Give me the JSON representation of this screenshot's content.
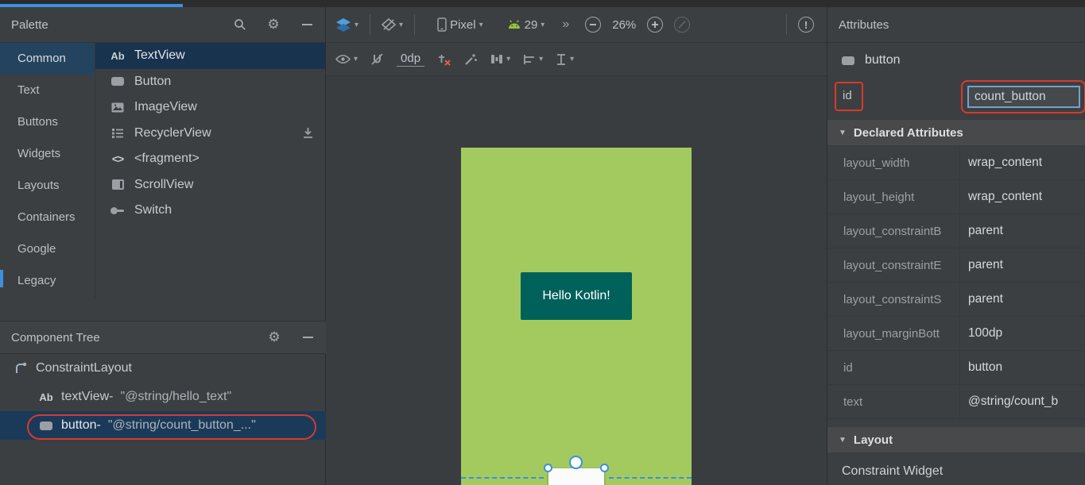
{
  "colors": {
    "accent-blue": "#3d8fe0",
    "annotation-red": "#d63a2e",
    "selection-navy": "#1b3a59",
    "palette-selection": "#24435f",
    "canvas-green": "#a3ca5e",
    "button-teal": "#00615a",
    "constraint-blue": "#3a8fe8",
    "android-green": "#9ac23c"
  },
  "icons": {
    "caret": "▾",
    "chevrons": "»",
    "gear": "⚙",
    "section_arrow": "▼",
    "error_mark": "!",
    "ab_glyph": "Ab",
    "fragment_glyph": "<>"
  },
  "palette": {
    "title": "Palette",
    "categories": [
      "Common",
      "Text",
      "Buttons",
      "Widgets",
      "Layouts",
      "Containers",
      "Google",
      "Legacy"
    ],
    "selected_category": "Common",
    "items": [
      {
        "label": "TextView"
      },
      {
        "label": "Button"
      },
      {
        "label": "ImageView"
      },
      {
        "label": "RecyclerView"
      },
      {
        "label": "<fragment>"
      },
      {
        "label": "ScrollView"
      },
      {
        "label": "Switch"
      }
    ]
  },
  "component_tree": {
    "title": "Component Tree",
    "items": [
      {
        "label": "ConstraintLayout",
        "value": ""
      },
      {
        "label": "textView-",
        "value": "\"@string/hello_text\""
      },
      {
        "label": "button-",
        "value": "\"@string/count_button_...\""
      }
    ]
  },
  "toolbar": {
    "device": "Pixel",
    "api_level": "29",
    "zoom_level": "26%",
    "default_margin": "0dp"
  },
  "canvas": {
    "hello_button_text": "Hello Kotlin!"
  },
  "attributes": {
    "title": "Attributes",
    "component_name": "button",
    "id_label": "id",
    "id_value": "count_button",
    "declared_section_title": "Declared Attributes",
    "declared_rows": [
      {
        "name": "layout_width",
        "value": "wrap_content"
      },
      {
        "name": "layout_height",
        "value": "wrap_content"
      },
      {
        "name": "layout_constraintB",
        "value": "parent"
      },
      {
        "name": "layout_constraintE",
        "value": "parent"
      },
      {
        "name": "layout_constraintS",
        "value": "parent"
      },
      {
        "name": "layout_marginBott",
        "value": "100dp"
      },
      {
        "name": "id",
        "value": "button"
      },
      {
        "name": "text",
        "value": "@string/count_b"
      }
    ],
    "layout_section_title": "Layout",
    "layout_widget_label": "Constraint Widget"
  }
}
